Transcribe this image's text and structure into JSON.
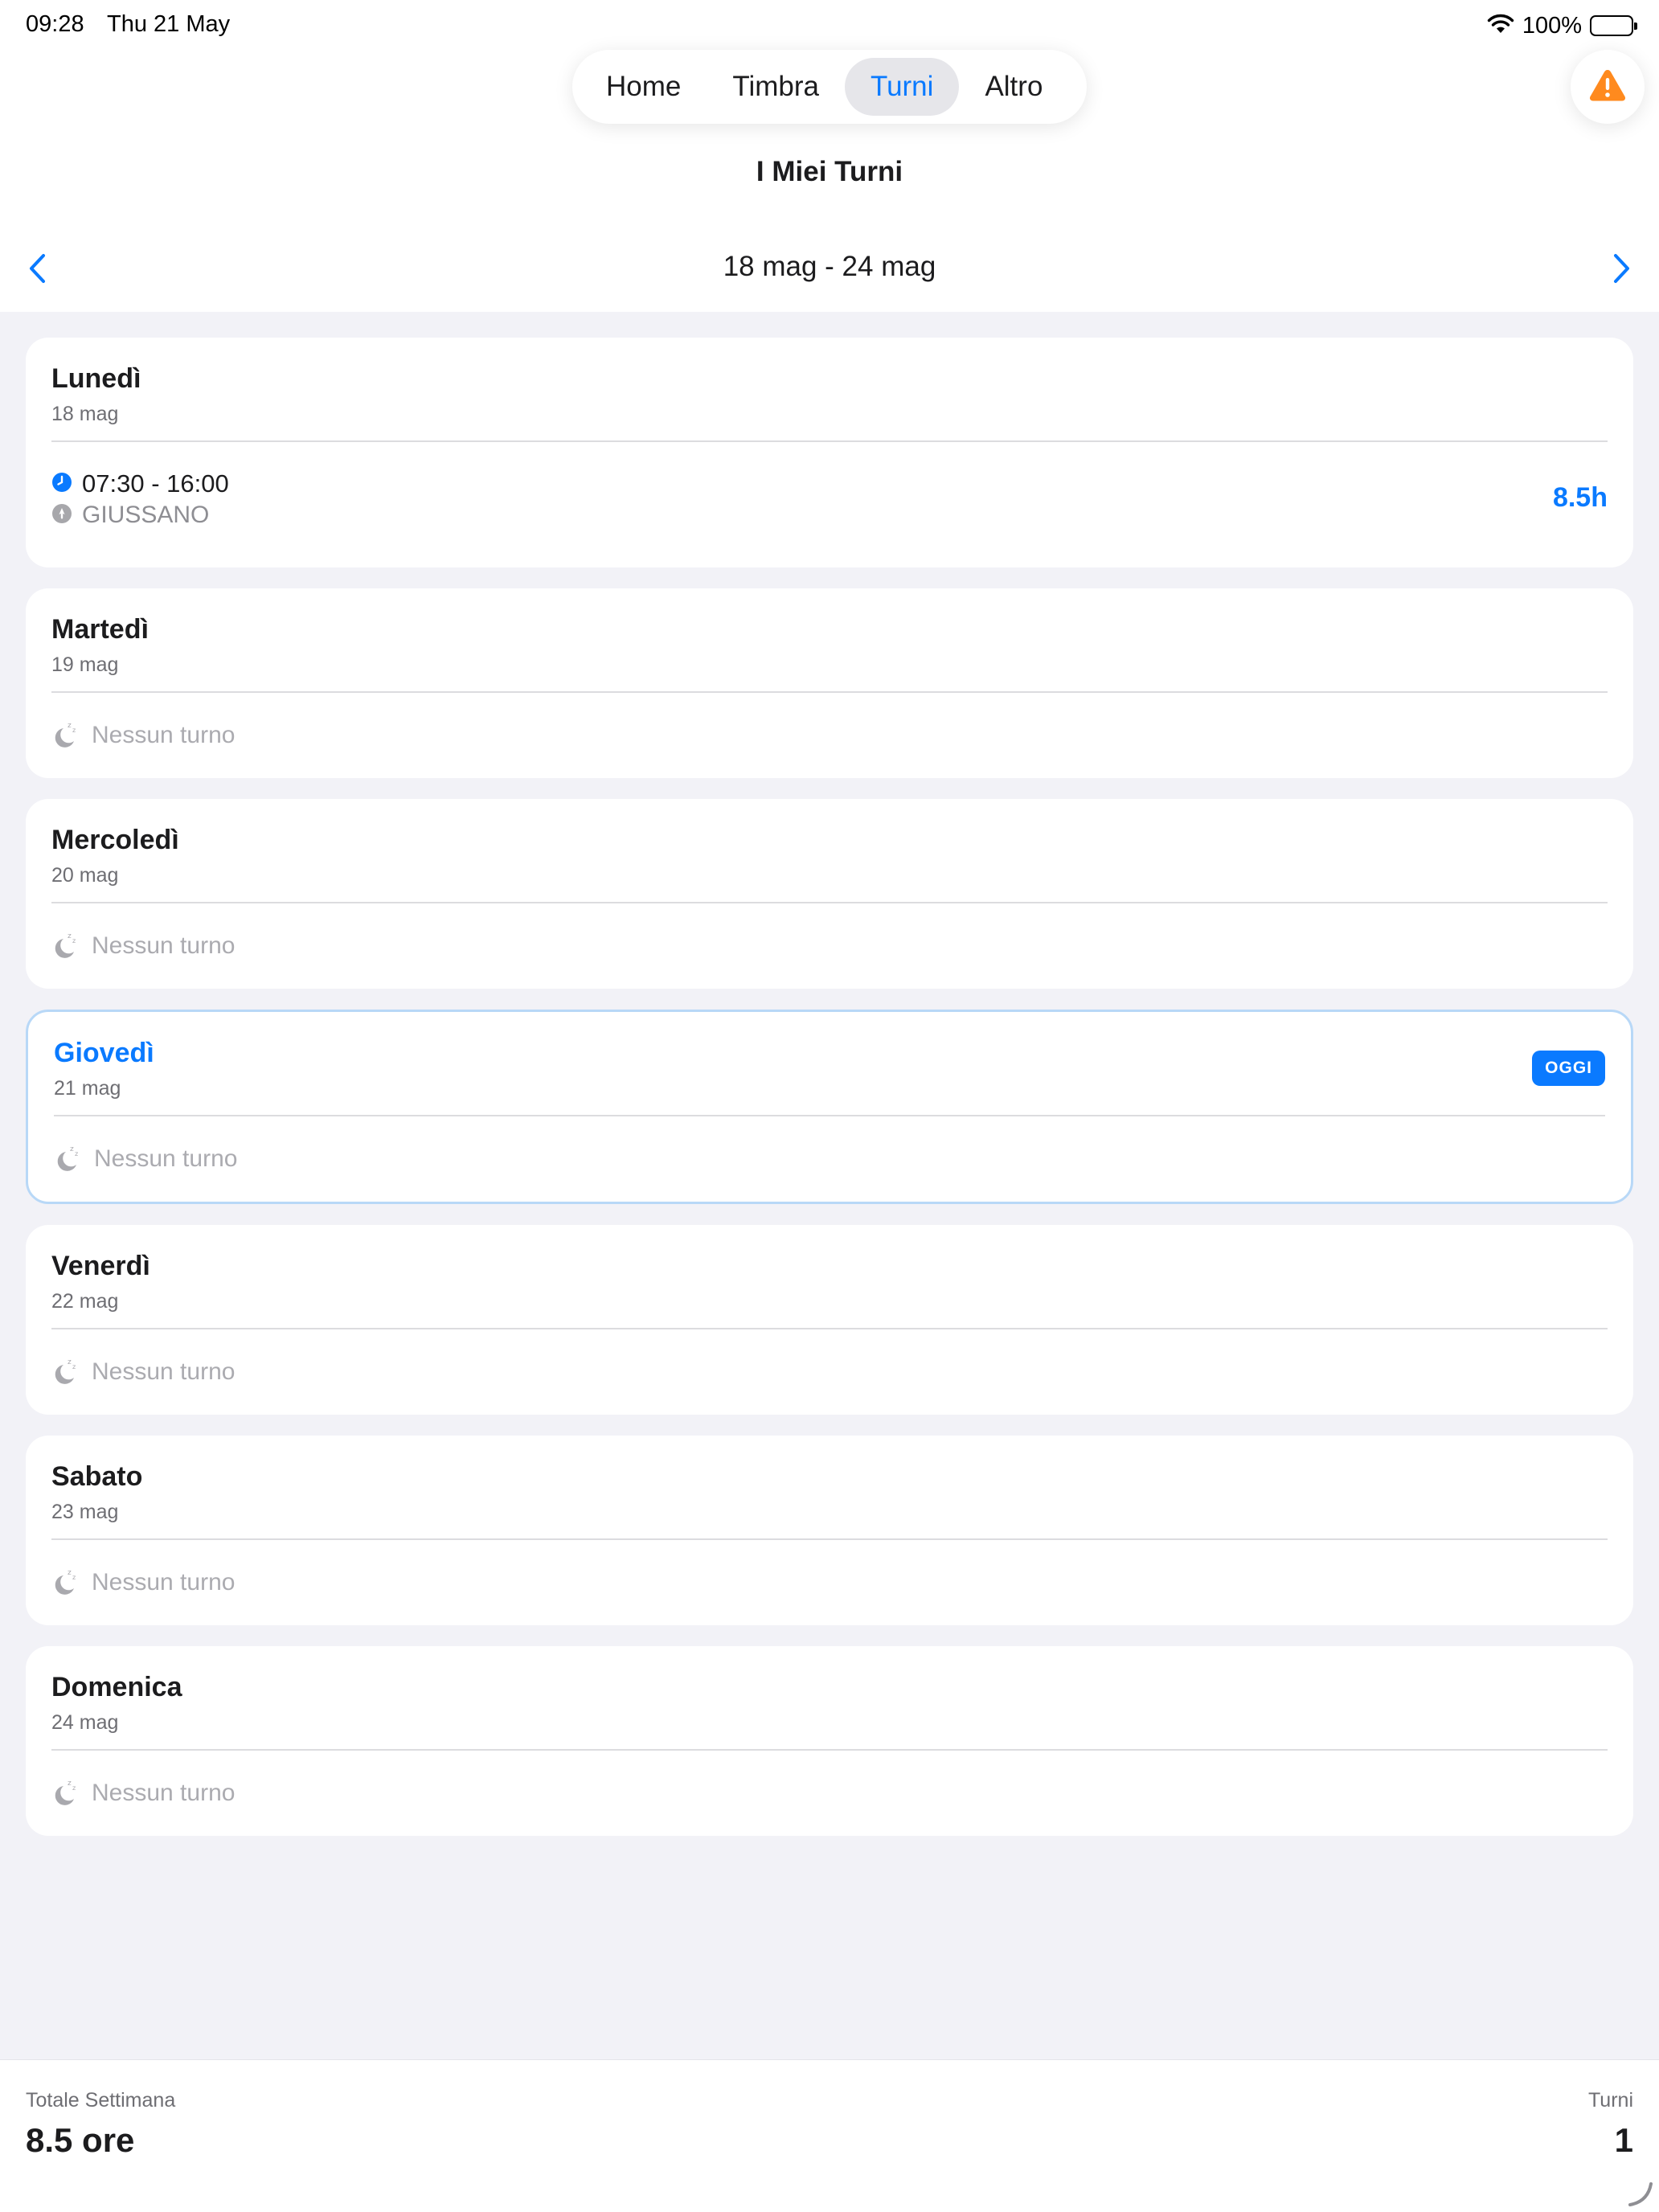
{
  "status_bar": {
    "time": "09:28",
    "date": "Thu 21 May",
    "battery_percent": "100%",
    "wifi_icon": "wifi-icon",
    "battery_icon": "battery-icon"
  },
  "nav": {
    "tabs": [
      {
        "label": "Home",
        "active": false
      },
      {
        "label": "Timbra",
        "active": false
      },
      {
        "label": "Turni",
        "active": true
      },
      {
        "label": "Altro",
        "active": false
      }
    ],
    "alert_icon": "warning-icon"
  },
  "page": {
    "title": "I Miei Turni",
    "week_label": "18 mag - 24 mag"
  },
  "days": [
    {
      "name": "Lunedì",
      "date": "18 mag",
      "today": false,
      "shift": {
        "time": "07:30 - 16:00",
        "location": "GIUSSANO",
        "hours": "8.5h"
      }
    },
    {
      "name": "Martedì",
      "date": "19 mag",
      "today": false,
      "empty_text": "Nessun turno"
    },
    {
      "name": "Mercoledì",
      "date": "20 mag",
      "today": false,
      "empty_text": "Nessun turno"
    },
    {
      "name": "Giovedì",
      "date": "21 mag",
      "today": true,
      "badge": "OGGI",
      "empty_text": "Nessun turno"
    },
    {
      "name": "Venerdì",
      "date": "22 mag",
      "today": false,
      "empty_text": "Nessun turno"
    },
    {
      "name": "Sabato",
      "date": "23 mag",
      "today": false,
      "empty_text": "Nessun turno"
    },
    {
      "name": "Domenica",
      "date": "24 mag",
      "today": false,
      "empty_text": "Nessun turno"
    }
  ],
  "summary": {
    "total_label": "Totale Settimana",
    "total_value": "8.5 ore",
    "count_label": "Turni",
    "count_value": "1"
  },
  "colors": {
    "accent": "#0a7aff",
    "warning": "#ff8a1e",
    "background": "#f2f2f7"
  }
}
